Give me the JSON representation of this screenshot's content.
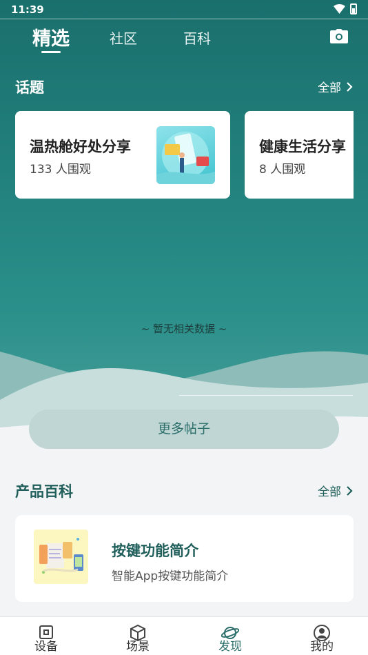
{
  "status_bar": {
    "time": "11:39"
  },
  "tabs": [
    {
      "label": "精选",
      "active": true
    },
    {
      "label": "社区",
      "active": false
    },
    {
      "label": "百科",
      "active": false
    }
  ],
  "topics": {
    "title": "话题",
    "more_label": "全部",
    "cards": [
      {
        "title": "温热舱好处分享",
        "viewers": "133 人围观"
      },
      {
        "title": "健康生活分享",
        "viewers": "8 人围观"
      }
    ]
  },
  "empty_text": "~ 暂无相关数据 ~",
  "more_posts_label": "更多帖子",
  "product_wiki": {
    "title": "产品百科",
    "more_label": "全部",
    "items": [
      {
        "title": "按键功能简介",
        "subtitle": "智能App按键功能简介"
      }
    ]
  },
  "bottom_nav": [
    {
      "label": "设备",
      "icon": "device-icon",
      "active": false
    },
    {
      "label": "场景",
      "icon": "cube-icon",
      "active": false
    },
    {
      "label": "发现",
      "icon": "planet-icon",
      "active": true
    },
    {
      "label": "我的",
      "icon": "user-icon",
      "active": false
    }
  ],
  "colors": {
    "primary": "#1f706c",
    "accent": "#2c6f6b",
    "button_bg": "#bfd6d4"
  }
}
